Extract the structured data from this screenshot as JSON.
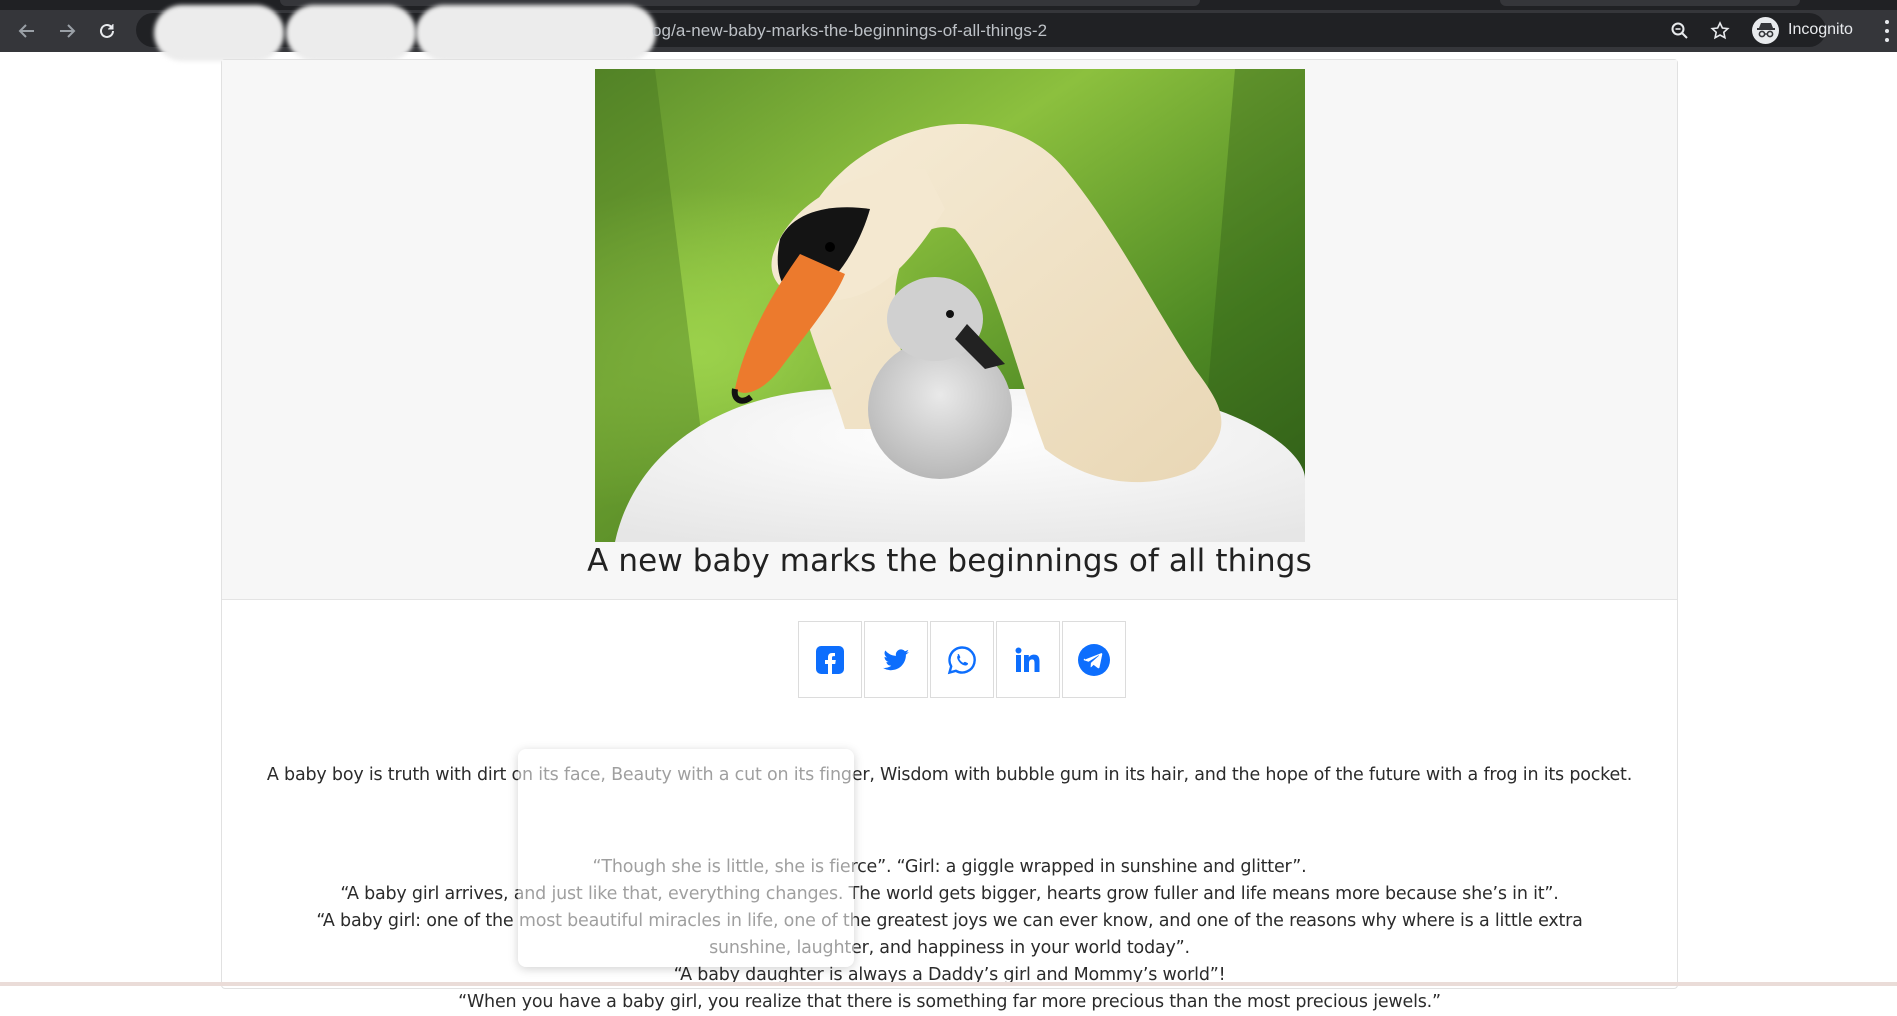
{
  "browser": {
    "url_visible": "og/a-new-baby-marks-the-beginnings-of-all-things-2",
    "profile_label": "Incognito",
    "icons": [
      "back-arrow-icon",
      "forward-arrow-icon",
      "reload-icon",
      "zoom-icon",
      "star-icon",
      "incognito-icon",
      "more-menu-icon"
    ]
  },
  "post": {
    "title": "A new baby marks the beginnings of all things",
    "hero_alt": "Swan with cygnet",
    "share": [
      {
        "network": "facebook",
        "icon": "facebook-icon"
      },
      {
        "network": "twitter",
        "icon": "twitter-icon"
      },
      {
        "network": "whatsapp",
        "icon": "whatsapp-icon"
      },
      {
        "network": "linkedin",
        "icon": "linkedin-icon"
      },
      {
        "network": "telegram",
        "icon": "telegram-icon"
      }
    ],
    "lead": "A baby boy is truth with dirt on its face, Beauty with a cut on its finger, Wisdom with bubble gum in its hair, and the hope of the future with a frog in its pocket.",
    "quotes": [
      "“Though she is little, she is fierce”. “Girl: a giggle wrapped in sunshine and glitter”.",
      "“A baby girl arrives, and just like that, everything changes. The world gets bigger, hearts grow fuller and life means more because she’s in it”.",
      "“A baby girl: one of the most beautiful miracles in life, one of the greatest joys we can ever know, and one of the reasons why where is a little extra sunshine, laughter, and happiness in your world today”.",
      "“A baby daughter is always a Daddy’s girl and Mommy’s world”!",
      "“When you have a baby girl, you realize that there is something far more precious than the most precious jewels.”"
    ]
  },
  "colors": {
    "share_blue": "#0d6efd",
    "chrome_toolbar": "#35363a",
    "omnibox": "#202124",
    "header_bg": "#f7f7f7"
  }
}
